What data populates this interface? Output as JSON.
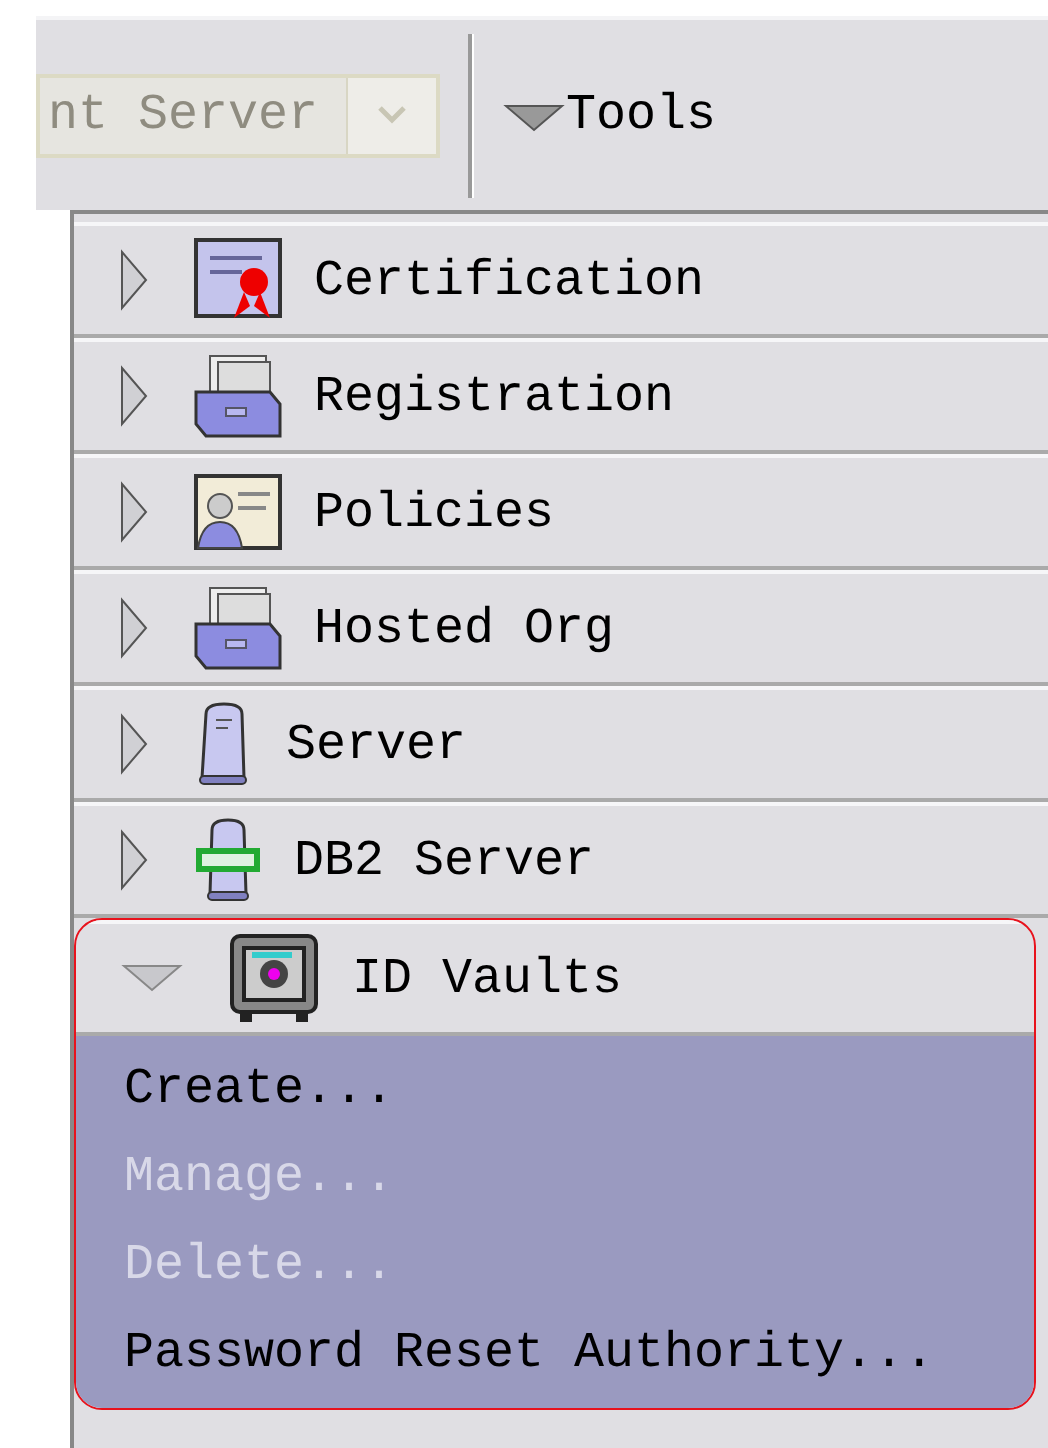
{
  "toolbar": {
    "server_combo": {
      "value": "nt Server",
      "disabled": true
    },
    "tools_menu": {
      "label": "Tools",
      "expanded": false
    }
  },
  "sections": [
    {
      "label": "Certification",
      "kind": "certificate",
      "expanded": false
    },
    {
      "label": "Registration",
      "kind": "cardfile",
      "expanded": false
    },
    {
      "label": "Policies",
      "kind": "policy",
      "expanded": false
    },
    {
      "label": "Hosted Org",
      "kind": "cardfile",
      "expanded": false
    },
    {
      "label": "Server",
      "kind": "server",
      "expanded": false
    },
    {
      "label": "DB2 Server",
      "kind": "db2",
      "expanded": false
    },
    {
      "label": "ID Vaults",
      "kind": "vault",
      "expanded": true,
      "highlighted": true,
      "items": [
        {
          "label": "Create...",
          "disabled": false
        },
        {
          "label": "Manage...",
          "disabled": true
        },
        {
          "label": "Delete...",
          "disabled": true
        },
        {
          "label": "Password Reset Authority...",
          "disabled": false
        }
      ]
    }
  ]
}
